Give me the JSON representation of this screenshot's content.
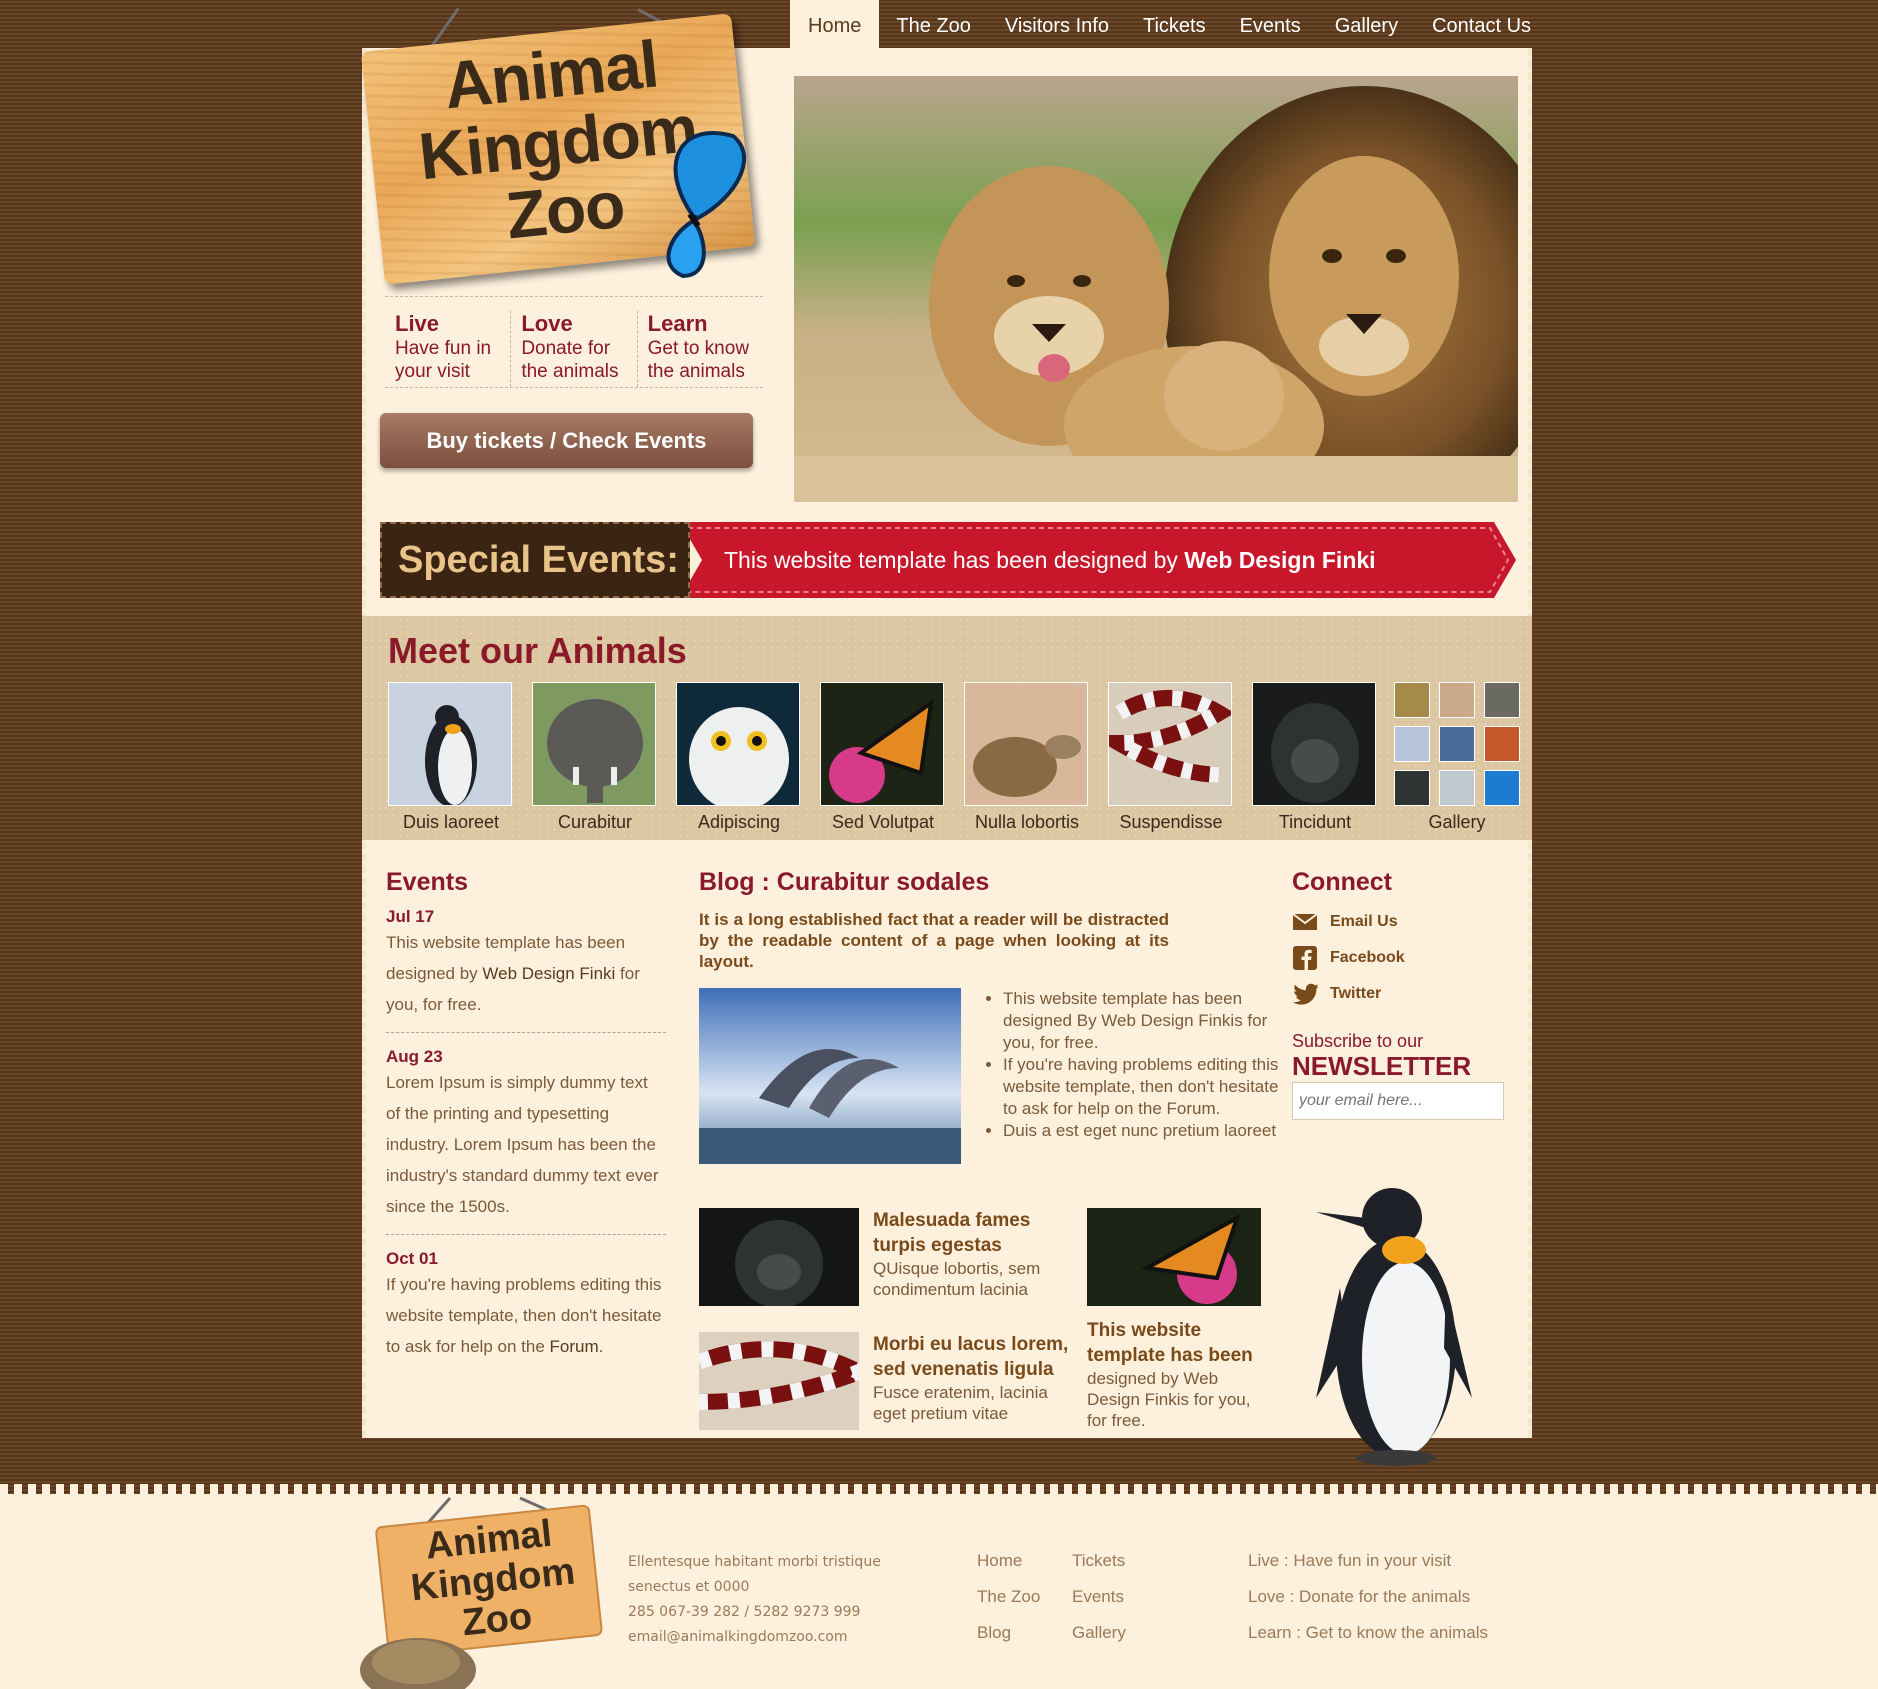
{
  "nav": {
    "items": [
      "Home",
      "The Zoo",
      "Visitors Info",
      "Tickets",
      "Events",
      "Gallery",
      "Contact Us"
    ]
  },
  "logo": {
    "line1": "Animal",
    "line2": "Kingdom",
    "line3": "Zoo"
  },
  "taglines": [
    {
      "title": "Live",
      "text1": "Have fun in",
      "text2": "your visit"
    },
    {
      "title": "Love",
      "text1": "Donate for",
      "text2": "the animals"
    },
    {
      "title": "Learn",
      "text1": "Get to know",
      "text2": "the animals"
    }
  ],
  "buy_button": "Buy tickets / Check Events",
  "special_events": {
    "label": "Special Events:",
    "text": "This website template has been designed by ",
    "link": "Web Design Finki"
  },
  "meet": {
    "title": "Meet our Animals",
    "animals": [
      "Duis laoreet",
      "Curabitur",
      "Adipiscing",
      "Sed Volutpat",
      "Nulla lobortis",
      "Suspendisse",
      "Tincidunt"
    ],
    "gallery_label": "Gallery"
  },
  "events": {
    "title": "Events",
    "items": [
      {
        "date": "Jul 17",
        "text_a": "This website template has been designed by ",
        "link": "Web Design Finki",
        "text_b": " for you, for free."
      },
      {
        "date": "Aug 23",
        "text_a": "Lorem Ipsum is simply dummy text of the printing and typesetting industry. Lorem Ipsum has been the industry's standard dummy text ever since the 1500s.",
        "link": "",
        "text_b": ""
      },
      {
        "date": "Oct 01",
        "text_a": "If you're having problems editing this website template, then don't hesitate to ask for help on the ",
        "link": "Forum",
        "text_b": "."
      }
    ]
  },
  "blog": {
    "title": "Blog : Curabitur sodales",
    "lead": "It is a long established fact that a reader will be distracted by the readable content of a page when looking at its layout.",
    "list": {
      "li1": "This website template has been designed By ",
      "li1_link": "Web Design Finkis",
      "li1_tail": " for you, for free.",
      "li2": "If you're having problems editing this website template, then don't hesitate to ask for help on the ",
      "li2_link": "Forum",
      "li2_tail": ".",
      "li3": "Duis a est eget nunc pretium laoreet"
    },
    "cards": [
      {
        "title": "Malesuada fames turpis egestas",
        "text": "QUisque lobortis, sem condimentum lacinia"
      },
      {
        "title": "This website template has been",
        "text": "designed by ",
        "link": "Web Design Finkis",
        "tail": " for you, for free."
      },
      {
        "title": "Morbi eu lacus lorem, sed venenatis ligula",
        "text": "Fusce eratenim, lacinia eget pretium vitae"
      }
    ]
  },
  "connect": {
    "title": "Connect",
    "items": [
      "Email Us",
      "Facebook",
      "Twitter"
    ],
    "subscribe": "Subscribe to our",
    "newsletter": "NEWSLETTER",
    "email_placeholder": "your email here..."
  },
  "footer": {
    "logo": {
      "line1": "Animal",
      "line2": "Kingdom",
      "line3": "Zoo"
    },
    "contact": [
      "Ellentesque habitant morbi tristique",
      "senectus et 0000",
      "285 067-39 282 / 5282 9273 999",
      "email@animalkingdomzoo.com"
    ],
    "links_a": [
      "Home",
      "The Zoo",
      "Blog"
    ],
    "links_b": [
      "Tickets",
      "Events",
      "Gallery"
    ],
    "taglines": [
      "Live : Have fun in your visit",
      "Love : Donate for the animals",
      "Learn : Get to know the animals"
    ]
  },
  "colors": {
    "accent": "#8a1a2a",
    "ribbon": "#c8172b",
    "brown": "#5a3a1f",
    "cream": "#fdf0dc"
  }
}
